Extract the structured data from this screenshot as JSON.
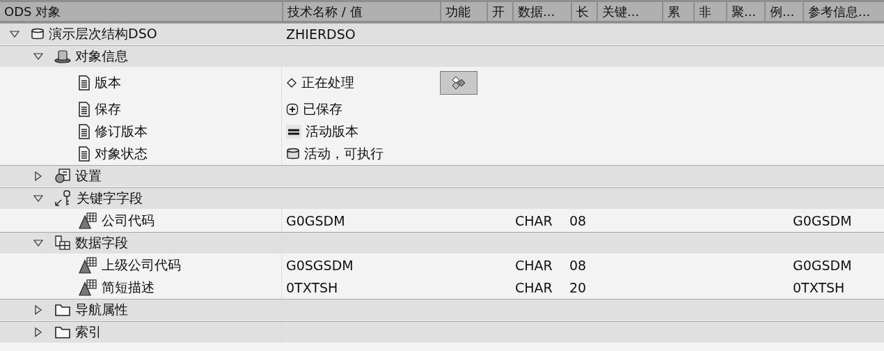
{
  "columns": [
    "ODS 对象",
    "技术名称 / 值",
    "功能",
    "开",
    "数据...",
    "长",
    "关键...",
    "累",
    "非",
    "聚...",
    "例...",
    "参考信息..."
  ],
  "tree": [
    {
      "label": "演示层次结构DSO",
      "kind": "database",
      "expanded": true,
      "value": "ZHIERDSO",
      "children": [
        {
          "label": "对象信息",
          "kind": "hat",
          "expanded": true,
          "children": [
            {
              "label": "版本",
              "kind": "document",
              "status": {
                "kind": "diamond",
                "text": "正在处理"
              },
              "function_button": true
            },
            {
              "label": "保存",
              "kind": "document",
              "status": {
                "kind": "plus",
                "text": "已保存"
              }
            },
            {
              "label": "修订版本",
              "kind": "document",
              "status": {
                "kind": "equals",
                "text": "活动版本"
              }
            },
            {
              "label": "对象状态",
              "kind": "document",
              "status": {
                "kind": "database",
                "text": "活动，可执行"
              }
            }
          ]
        },
        {
          "label": "设置",
          "kind": "settings",
          "expanded": false
        },
        {
          "label": "关键字字段",
          "kind": "key",
          "expanded": true,
          "children": [
            {
              "label": "公司代码",
              "kind": "field",
              "value": "G0GSDM",
              "data_type": "CHAR",
              "length": "08",
              "reference": "G0GSDM"
            }
          ]
        },
        {
          "label": "数据字段",
          "kind": "datafields",
          "expanded": true,
          "children": [
            {
              "label": "上级公司代码",
              "kind": "field",
              "value": "G0SGSDM",
              "data_type": "CHAR",
              "length": "08",
              "reference": "G0GSDM"
            },
            {
              "label": "简短描述",
              "kind": "field",
              "value": "0TXTSH",
              "data_type": "CHAR",
              "length": "20",
              "reference": "0TXTSH"
            }
          ]
        },
        {
          "label": "导航属性",
          "kind": "folder",
          "expanded": false
        },
        {
          "label": "索引",
          "kind": "folder",
          "expanded": false
        }
      ]
    }
  ]
}
